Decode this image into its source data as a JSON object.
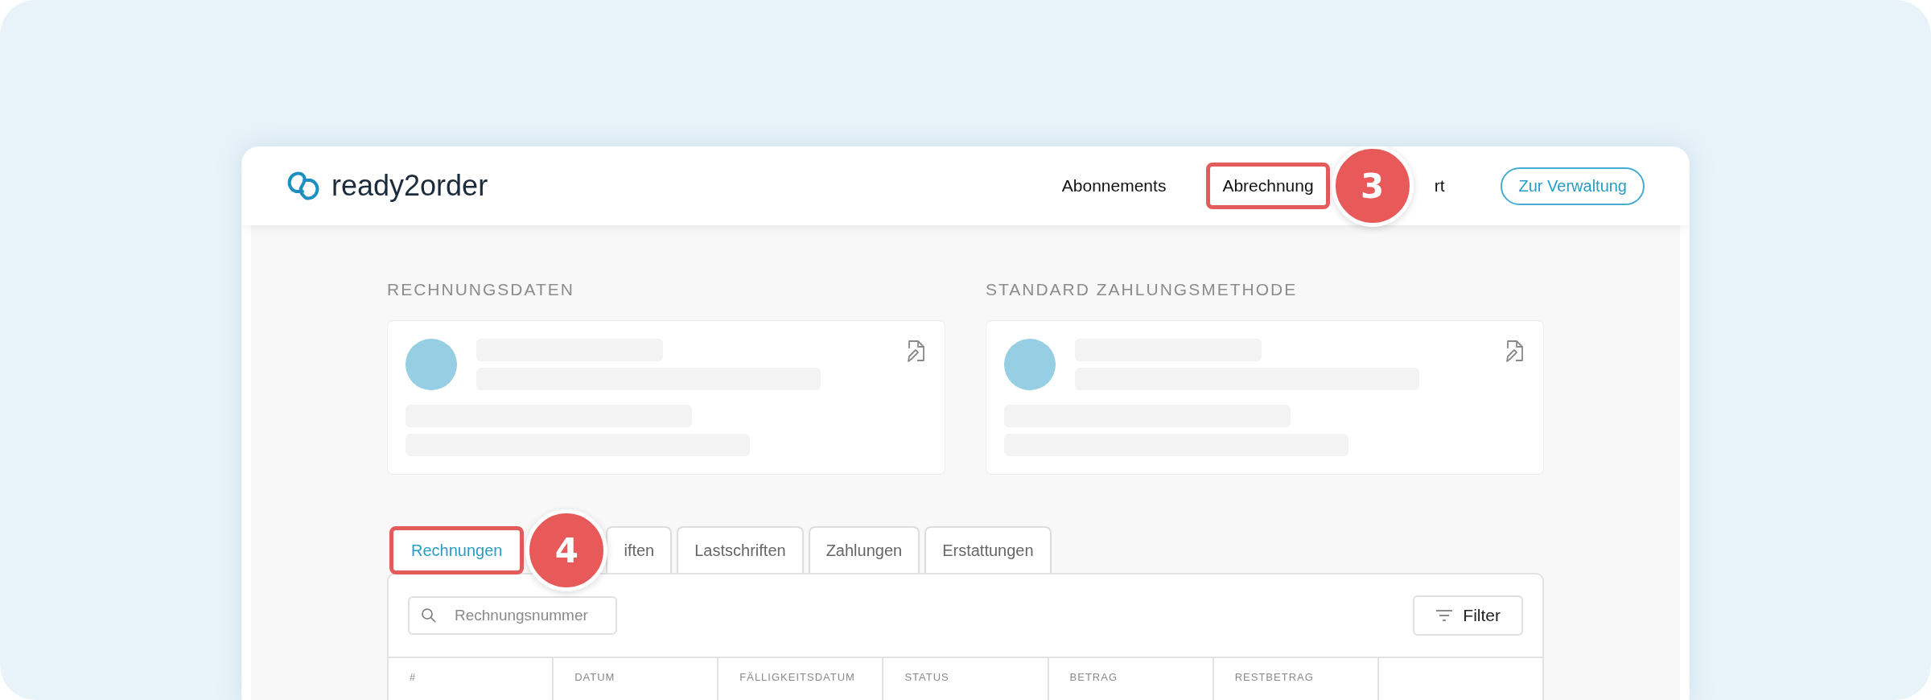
{
  "header": {
    "logo_text": "ready2order",
    "nav": [
      {
        "label": "Abonnements",
        "highlighted": false
      },
      {
        "label": "Abrechnung",
        "highlighted": true,
        "callout": "3"
      },
      {
        "label": "rt",
        "highlighted": false
      }
    ],
    "button": "Zur Verwaltung"
  },
  "sections": [
    {
      "title": "RECHNUNGSDATEN"
    },
    {
      "title": "STANDARD ZAHLUNGSMETHODE"
    }
  ],
  "tabs": [
    {
      "label": "Rechnungen",
      "selected": true,
      "highlighted": true,
      "callout": "4"
    },
    {
      "label": "iften",
      "selected": false,
      "highlighted": false
    },
    {
      "label": "Lastschriften",
      "selected": false,
      "highlighted": false
    },
    {
      "label": "Zahlungen",
      "selected": false,
      "highlighted": false
    },
    {
      "label": "Erstattungen",
      "selected": false,
      "highlighted": false
    }
  ],
  "table": {
    "search": {
      "placeholder": "Rechnungsnummer"
    },
    "filter_button": "Filter",
    "columns": [
      "#",
      "DATUM",
      "FÄLLIGKEITSDATUM",
      "STATUS",
      "BETRAG",
      "RESTBETRAG",
      ""
    ]
  }
}
